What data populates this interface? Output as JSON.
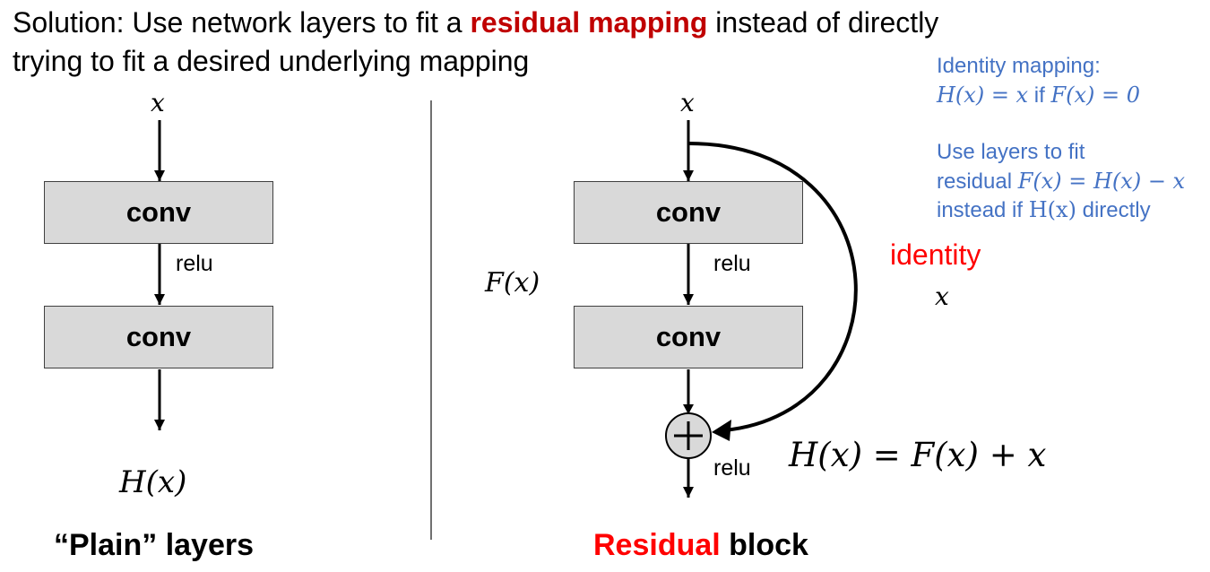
{
  "headline": {
    "part1": "Solution: Use network layers to fit a ",
    "highlight": "residual mapping",
    "part2": " instead of directly",
    "line2": "trying to fit a desired underlying mapping"
  },
  "notes": {
    "identity_title": "Identity mapping:",
    "identity_formula_lhs": "H(x) = x",
    "identity_if": " if ",
    "identity_formula_rhs": "F(x) = 0",
    "fit_line1": "Use layers to fit",
    "fit_line2_word": "residual ",
    "fit_line2_formula": "F(x) = H(x) − x",
    "fit_line3_word": "instead if ",
    "fit_line3_formula": "H(x)",
    "fit_line3_end": " directly"
  },
  "plain": {
    "input": "x",
    "conv1": "conv",
    "relu": "relu",
    "conv2": "conv",
    "output": "H(x)",
    "caption": "“Plain” layers"
  },
  "residual": {
    "input": "x",
    "conv1": "conv",
    "relu1": "relu",
    "conv2": "conv",
    "fx": "F(x)",
    "identity_label": "identity",
    "identity_x": "x",
    "plus": "+",
    "relu2": "relu",
    "formula": "H(x) = F(x) + x",
    "caption_highlight": "Residual",
    "caption_rest": " block"
  },
  "colors": {
    "highlight_red": "#c00000",
    "identity_red": "#ff0000",
    "note_blue": "#4472c4",
    "box_fill": "#d9d9d9"
  }
}
